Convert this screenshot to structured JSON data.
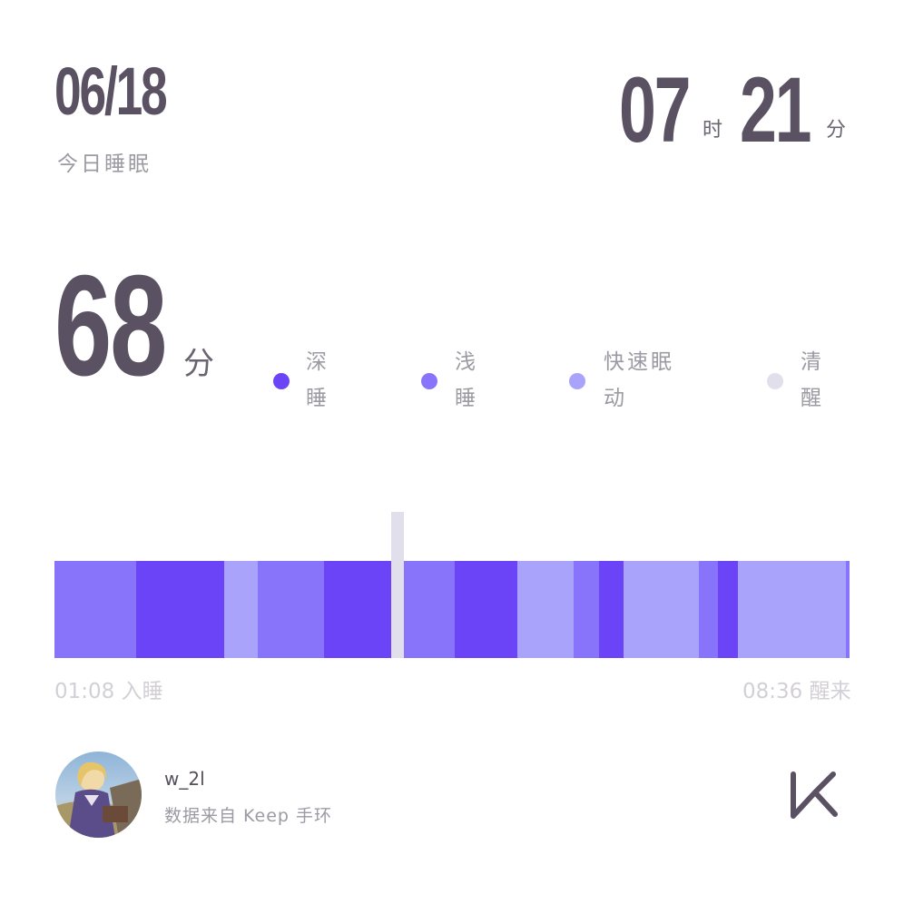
{
  "header": {
    "date": "06/18",
    "date_label": "今日睡眠",
    "duration_hours": "07",
    "hours_unit": "时",
    "duration_minutes": "21",
    "minutes_unit": "分"
  },
  "score": {
    "value": "68",
    "unit": "分"
  },
  "legend": [
    {
      "line1": "深",
      "line2": "睡",
      "color": "#6c44f7"
    },
    {
      "line1": "浅",
      "line2": "睡",
      "color": "#8874fa"
    },
    {
      "line1": "快速眠",
      "line2": "动",
      "color": "#aaa3fb"
    },
    {
      "line1": "清",
      "line2": "醒",
      "color": "#e1dfeb"
    }
  ],
  "timeline": {
    "start_label": "01:08 入睡",
    "end_label": "08:36 醒来",
    "colors": {
      "deep": "#6c44f7",
      "light": "#8874fa",
      "rem": "#aaa3fb",
      "awake": "#e1dfeb"
    },
    "segments": [
      {
        "stage": "light",
        "start": 0.0,
        "end": 0.103
      },
      {
        "stage": "deep",
        "start": 0.103,
        "end": 0.214
      },
      {
        "stage": "rem",
        "start": 0.214,
        "end": 0.256
      },
      {
        "stage": "light",
        "start": 0.256,
        "end": 0.339
      },
      {
        "stage": "deep",
        "start": 0.339,
        "end": 0.423
      },
      {
        "stage": "awake",
        "start": 0.423,
        "end": 0.439
      },
      {
        "stage": "light",
        "start": 0.439,
        "end": 0.503
      },
      {
        "stage": "deep",
        "start": 0.503,
        "end": 0.582
      },
      {
        "stage": "rem",
        "start": 0.582,
        "end": 0.653
      },
      {
        "stage": "light",
        "start": 0.653,
        "end": 0.685
      },
      {
        "stage": "deep",
        "start": 0.685,
        "end": 0.716
      },
      {
        "stage": "rem",
        "start": 0.716,
        "end": 0.81
      },
      {
        "stage": "light",
        "start": 0.81,
        "end": 0.835
      },
      {
        "stage": "deep",
        "start": 0.835,
        "end": 0.86
      },
      {
        "stage": "rem",
        "start": 0.86,
        "end": 0.996
      },
      {
        "stage": "light",
        "start": 0.996,
        "end": 1.0
      }
    ]
  },
  "footer": {
    "username": "w_2l",
    "source": "数据来自 Keep 手环",
    "logo_icon": "keep-k-logo"
  }
}
